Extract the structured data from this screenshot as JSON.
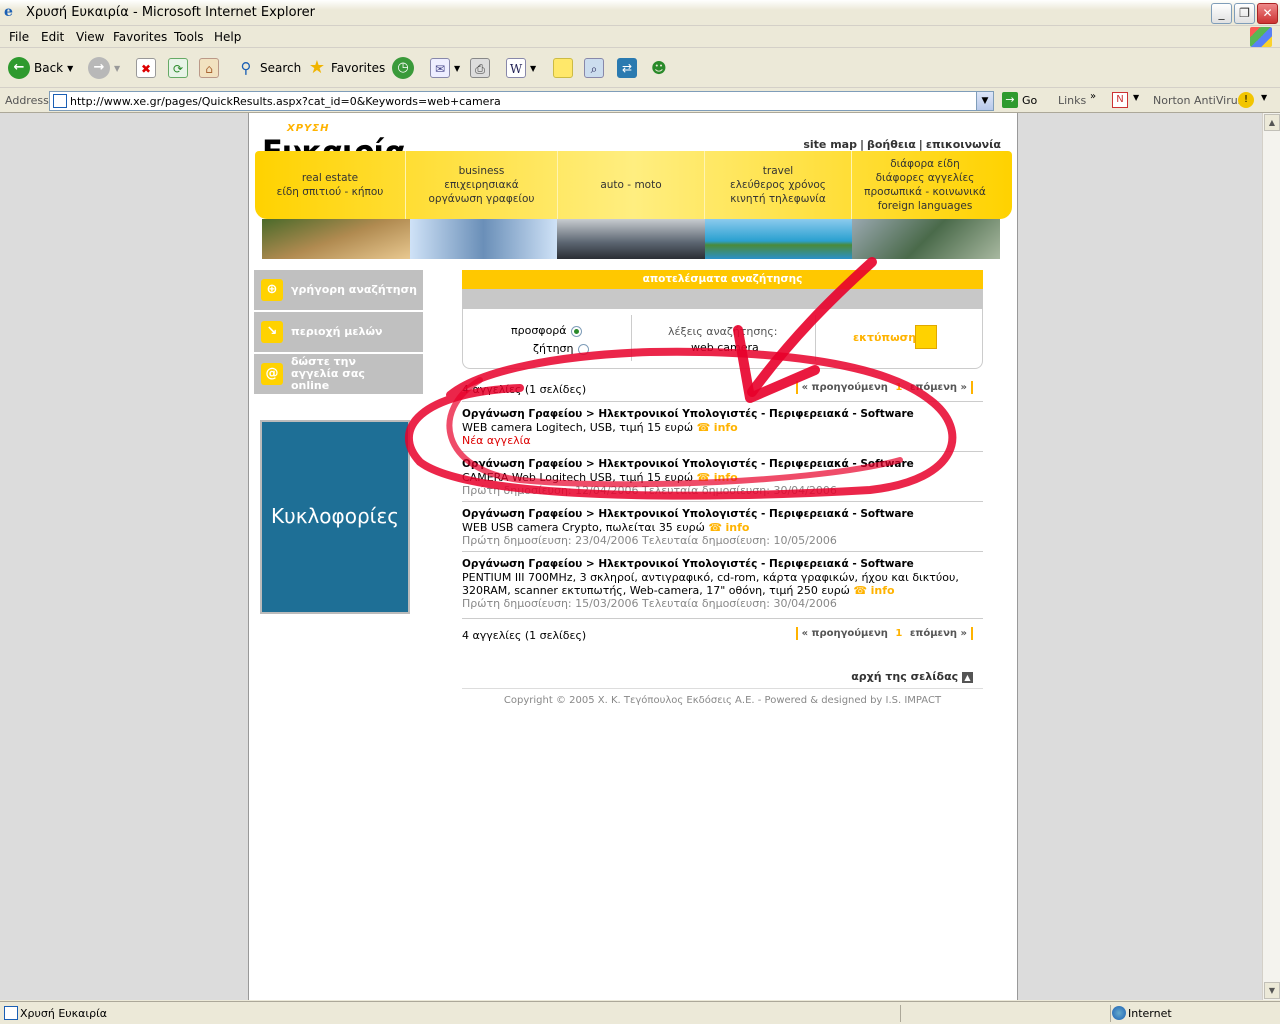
{
  "window": {
    "title": "Χρυσή Ευκαιρία - Microsoft Internet Explorer"
  },
  "menu": [
    "File",
    "Edit",
    "View",
    "Favorites",
    "Tools",
    "Help"
  ],
  "toolbar": {
    "back": "Back",
    "search": "Search",
    "favorites": "Favorites"
  },
  "address": {
    "label": "Address",
    "url": "http://www.xe.gr/pages/QuickResults.aspx?cat_id=0&Keywords=web+camera",
    "go": "Go",
    "links": "Links",
    "norton": "Norton AntiVirus"
  },
  "site": {
    "logo_small": "ΧΡΥΣΗ",
    "logo_big": "Ευκαιρία",
    "toplinks": [
      "site map",
      "βοήθεια",
      "επικοινωνία"
    ],
    "nav": [
      {
        "lines": [
          "real estate",
          "είδη σπιτιού - κήπου"
        ]
      },
      {
        "lines": [
          "business",
          "επιχειρησιακά",
          "οργάνωση γραφείου"
        ]
      },
      {
        "lines": [
          "auto - moto"
        ]
      },
      {
        "lines": [
          "travel",
          "ελεύθερος χρόνος",
          "κινητή τηλεφωνία"
        ]
      },
      {
        "lines": [
          "διάφορα είδη",
          "διάφορες αγγελίες",
          "προσωπικά - κοινωνικά",
          "foreign languages"
        ]
      }
    ],
    "photo_colors": [
      "#8a7a40",
      "#9ec0e8",
      "#7a8a96",
      "#4aa8d8",
      "#7a8a6a"
    ]
  },
  "sidebar": {
    "buttons": [
      {
        "icon": "search-plus-icon",
        "glyph": "⊕",
        "label": "γρήγορη αναζήτηση"
      },
      {
        "icon": "member-arrow-icon",
        "glyph": "↘",
        "label": "περιοχή μελών"
      },
      {
        "icon": "online-ad-icon",
        "glyph": "@",
        "label": "δώστε την αγγελία σας online"
      }
    ],
    "promo": "Κυκλοφορίες"
  },
  "results": {
    "header": "αποτελέσματα αναζήτησης",
    "offer_label": "προσφορά",
    "demand_label": "ζήτηση",
    "keywords_label": "λέξεις αναζήτησης:",
    "keywords_value": "web camera",
    "print_label": "εκτύπωση",
    "count_text": "4 αγγελίες (1 σελίδες)",
    "prev": "προηγούμενη",
    "page": "1",
    "next": "επόμενη",
    "items": [
      {
        "category": "Οργάνωση Γραφείου > Ηλεκτρονικοί Υπολογιστές - Περιφερειακά - Software",
        "text": "WEB camera Logitech, USB, τιμή 15 ευρώ",
        "info": "info",
        "extra": "Νέα αγγελία",
        "extra_type": "new"
      },
      {
        "category": "Οργάνωση Γραφείου > Ηλεκτρονικοί Υπολογιστές - Περιφερειακά - Software",
        "text": "CAMERA Web Logitech USB, τιμή 15 ευρώ",
        "info": "info",
        "extra": "Πρώτη δημοσίευση: 12/04/2006 Τελευταία δημοσίευση: 30/04/2006",
        "extra_type": "dates"
      },
      {
        "category": "Οργάνωση Γραφείου > Ηλεκτρονικοί Υπολογιστές - Περιφερειακά - Software",
        "text": "WEB USB camera Crypto, πωλείται 35 ευρώ",
        "info": "info",
        "extra": "Πρώτη δημοσίευση: 23/04/2006 Τελευταία δημοσίευση: 10/05/2006",
        "extra_type": "dates"
      },
      {
        "category": "Οργάνωση Γραφείου > Ηλεκτρονικοί Υπολογιστές - Περιφερειακά - Software",
        "text": "PENTIUM III 700MHz, 3 σκληροί, αντιγραφικό, cd-rom, κάρτα γραφικών, ήχου και δικτύου, 320RAM, scanner εκτυπωτής, Web-camera, 17\" οθόνη, τιμή 250 ευρώ",
        "info": "info",
        "extra": "Πρώτη δημοσίευση: 15/03/2006 Τελευταία δημοσίευση: 30/04/2006",
        "extra_type": "dates"
      }
    ],
    "to_top": "αρχή της σελίδας",
    "copyright": "Copyright © 2005 Χ. Κ. Τεγόπουλος Εκδόσεις Α.Ε. - Powered & designed by I.S. IMPACT"
  },
  "status": {
    "text": "Χρυσή Ευκαιρία",
    "zone": "Internet"
  },
  "colors": {
    "accent_yellow": "#ffc800",
    "marker_red": "#e8002a",
    "promo_blue": "#1e6f96"
  }
}
